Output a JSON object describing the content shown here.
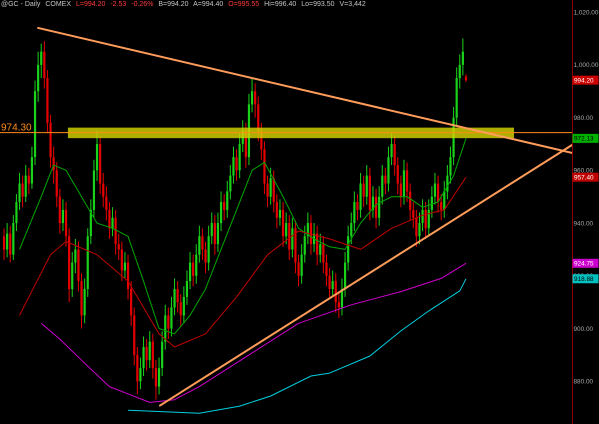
{
  "header": {
    "symbol": "@GC - Daily",
    "exchange": "COMEX",
    "last": "L=994.20",
    "change": "-2.53",
    "change_pct": "-0.26%",
    "bid": "B=994.20",
    "ask": "A=994.40",
    "open": "O=995.55",
    "high": "Hi=996.40",
    "low": "Lo=993.50",
    "volume": "V=3,442"
  },
  "chart_data": {
    "type": "bar",
    "subtype": "candlestick",
    "title": "",
    "xlabel": "",
    "ylabel": "",
    "xlim": [
      -1.3,
      183.2
    ],
    "ylim": [
      863.8,
      1024.6
    ],
    "grid": false,
    "colors": {
      "up": "#19d219",
      "down": "#e60000",
      "axis_text": "#a8a8a8",
      "axis_line": "#8b0000"
    },
    "yticks": [
      {
        "value": 1020,
        "label": "1,020.00"
      },
      {
        "value": 1000,
        "label": "1,000.00"
      },
      {
        "value": 980,
        "label": "980.00"
      },
      {
        "value": 960,
        "label": "960.00"
      },
      {
        "value": 940,
        "label": "940.00"
      },
      {
        "value": 920,
        "label": "920.00"
      },
      {
        "value": 900,
        "label": "900.00"
      },
      {
        "value": 880,
        "label": "880.00"
      }
    ],
    "ohlc": [
      [
        935,
        938,
        926,
        930
      ],
      [
        930,
        940,
        927,
        936
      ],
      [
        936,
        939,
        925,
        928
      ],
      [
        928,
        943,
        926,
        940
      ],
      [
        940,
        951,
        937,
        948
      ],
      [
        948,
        959,
        945,
        955
      ],
      [
        955,
        958,
        946,
        950
      ],
      [
        950,
        962,
        948,
        958
      ],
      [
        958,
        961,
        951,
        955
      ],
      [
        955,
        969,
        953,
        965
      ],
      [
        965,
        994,
        962,
        990
      ],
      [
        990,
        1005,
        986,
        1000
      ],
      [
        1000,
        1008,
        995,
        1005
      ],
      [
        1005,
        1009,
        991,
        995
      ],
      [
        995,
        998,
        974,
        978
      ],
      [
        978,
        981,
        961,
        965
      ],
      [
        965,
        969,
        955,
        960
      ],
      [
        960,
        963,
        946,
        950
      ],
      [
        950,
        953,
        936,
        940
      ],
      [
        940,
        949,
        937,
        945
      ],
      [
        945,
        948,
        931,
        935
      ],
      [
        935,
        938,
        910,
        915
      ],
      [
        915,
        929,
        912,
        925
      ],
      [
        925,
        934,
        921,
        930
      ],
      [
        930,
        933,
        914,
        918
      ],
      [
        918,
        921,
        900,
        905
      ],
      [
        905,
        919,
        902,
        915
      ],
      [
        915,
        938,
        912,
        935
      ],
      [
        935,
        949,
        932,
        945
      ],
      [
        945,
        964,
        942,
        960
      ],
      [
        960,
        975,
        956,
        970
      ],
      [
        970,
        973,
        951,
        955
      ],
      [
        955,
        959,
        946,
        950
      ],
      [
        950,
        954,
        941,
        945
      ],
      [
        945,
        948,
        934,
        938
      ],
      [
        938,
        946,
        935,
        942
      ],
      [
        942,
        945,
        928,
        932
      ],
      [
        932,
        936,
        926,
        930
      ],
      [
        930,
        933,
        918,
        922
      ],
      [
        922,
        929,
        919,
        925
      ],
      [
        925,
        928,
        911,
        915
      ],
      [
        915,
        918,
        901,
        905
      ],
      [
        905,
        908,
        886,
        890
      ],
      [
        890,
        893,
        875,
        880
      ],
      [
        880,
        889,
        877,
        885
      ],
      [
        885,
        897,
        882,
        893
      ],
      [
        893,
        896,
        884,
        888
      ],
      [
        888,
        899,
        885,
        895
      ],
      [
        895,
        898,
        881,
        885
      ],
      [
        885,
        888,
        873,
        878
      ],
      [
        878,
        889,
        875,
        885
      ],
      [
        885,
        899,
        882,
        895
      ],
      [
        895,
        909,
        892,
        905
      ],
      [
        905,
        908,
        896,
        900
      ],
      [
        900,
        912,
        897,
        908
      ],
      [
        908,
        919,
        905,
        915
      ],
      [
        915,
        918,
        906,
        910
      ],
      [
        910,
        913,
        901,
        905
      ],
      [
        905,
        916,
        902,
        912
      ],
      [
        912,
        922,
        909,
        918
      ],
      [
        918,
        929,
        915,
        925
      ],
      [
        925,
        928,
        916,
        920
      ],
      [
        920,
        932,
        917,
        928
      ],
      [
        928,
        939,
        925,
        935
      ],
      [
        935,
        938,
        926,
        930
      ],
      [
        930,
        933,
        921,
        925
      ],
      [
        925,
        939,
        922,
        935
      ],
      [
        935,
        944,
        932,
        940
      ],
      [
        940,
        943,
        928,
        932
      ],
      [
        932,
        944,
        929,
        940
      ],
      [
        940,
        952,
        937,
        948
      ],
      [
        948,
        951,
        941,
        945
      ],
      [
        945,
        956,
        942,
        952
      ],
      [
        952,
        962,
        949,
        958
      ],
      [
        958,
        969,
        955,
        965
      ],
      [
        965,
        968,
        956,
        960
      ],
      [
        960,
        974,
        957,
        970
      ],
      [
        970,
        979,
        967,
        975
      ],
      [
        975,
        978,
        961,
        965
      ],
      [
        965,
        989,
        962,
        985
      ],
      [
        985,
        995,
        982,
        990
      ],
      [
        990,
        993,
        980,
        985
      ],
      [
        985,
        988,
        971,
        975
      ],
      [
        975,
        978,
        964,
        968
      ],
      [
        968,
        971,
        951,
        955
      ],
      [
        955,
        958,
        946,
        950
      ],
      [
        950,
        961,
        947,
        957
      ],
      [
        957,
        960,
        944,
        948
      ],
      [
        948,
        951,
        938,
        942
      ],
      [
        942,
        949,
        939,
        945
      ],
      [
        945,
        948,
        931,
        935
      ],
      [
        935,
        944,
        932,
        940
      ],
      [
        940,
        943,
        926,
        930
      ],
      [
        930,
        942,
        927,
        938
      ],
      [
        938,
        941,
        921,
        925
      ],
      [
        925,
        928,
        916,
        920
      ],
      [
        920,
        932,
        917,
        928
      ],
      [
        928,
        939,
        925,
        935
      ],
      [
        935,
        944,
        932,
        940
      ],
      [
        940,
        943,
        928,
        932
      ],
      [
        932,
        940,
        929,
        936
      ],
      [
        936,
        939,
        924,
        928
      ],
      [
        928,
        936,
        925,
        932
      ],
      [
        932,
        935,
        921,
        925
      ],
      [
        925,
        928,
        916,
        920
      ],
      [
        920,
        923,
        911,
        915
      ],
      [
        915,
        922,
        912,
        918
      ],
      [
        918,
        921,
        906,
        910
      ],
      [
        910,
        914,
        904,
        908
      ],
      [
        908,
        919,
        905,
        915
      ],
      [
        915,
        929,
        912,
        925
      ],
      [
        925,
        939,
        922,
        935
      ],
      [
        935,
        944,
        932,
        940
      ],
      [
        940,
        952,
        937,
        948
      ],
      [
        948,
        951,
        941,
        945
      ],
      [
        945,
        959,
        942,
        955
      ],
      [
        955,
        958,
        946,
        950
      ],
      [
        950,
        962,
        947,
        958
      ],
      [
        958,
        961,
        941,
        945
      ],
      [
        945,
        954,
        942,
        950
      ],
      [
        950,
        953,
        938,
        942
      ],
      [
        942,
        954,
        939,
        950
      ],
      [
        950,
        962,
        947,
        958
      ],
      [
        958,
        961,
        951,
        955
      ],
      [
        955,
        969,
        952,
        965
      ],
      [
        965,
        974,
        962,
        970
      ],
      [
        970,
        973,
        958,
        962
      ],
      [
        962,
        965,
        951,
        955
      ],
      [
        955,
        958,
        946,
        950
      ],
      [
        950,
        964,
        947,
        960
      ],
      [
        960,
        963,
        948,
        952
      ],
      [
        952,
        955,
        941,
        945
      ],
      [
        945,
        948,
        938,
        942
      ],
      [
        942,
        945,
        931,
        935
      ],
      [
        935,
        944,
        932,
        940
      ],
      [
        940,
        949,
        937,
        945
      ],
      [
        945,
        948,
        934,
        938
      ],
      [
        938,
        949,
        935,
        945
      ],
      [
        945,
        954,
        942,
        950
      ],
      [
        950,
        959,
        947,
        955
      ],
      [
        955,
        958,
        944,
        948
      ],
      [
        948,
        951,
        941,
        945
      ],
      [
        945,
        956,
        942,
        952
      ],
      [
        952,
        962,
        949,
        958
      ],
      [
        958,
        969,
        955,
        965
      ],
      [
        965,
        984,
        962,
        980
      ],
      [
        980,
        999,
        977,
        995
      ],
      [
        995,
        1004,
        991,
        1000
      ],
      [
        1000,
        1010,
        996,
        1005
      ],
      [
        995.55,
        996.4,
        993.5,
        994.2
      ]
    ],
    "lines": [
      {
        "color": "#00a800",
        "points": [
          [
            5,
            930
          ],
          [
            12,
            950
          ],
          [
            16,
            962
          ],
          [
            20,
            960
          ],
          [
            25,
            950
          ],
          [
            30,
            940
          ],
          [
            35,
            938
          ],
          [
            40,
            935
          ],
          [
            45,
            918
          ],
          [
            50,
            900
          ],
          [
            55,
            898
          ],
          [
            60,
            905
          ],
          [
            65,
            915
          ],
          [
            70,
            930
          ],
          [
            75,
            945
          ],
          [
            80,
            960
          ],
          [
            84,
            963
          ],
          [
            90,
            950
          ],
          [
            95,
            938
          ],
          [
            100,
            934
          ],
          [
            105,
            931
          ],
          [
            110,
            930
          ],
          [
            115,
            940
          ],
          [
            120,
            947
          ],
          [
            125,
            950
          ],
          [
            130,
            950
          ],
          [
            135,
            946
          ],
          [
            140,
            948
          ],
          [
            145,
            958
          ],
          [
            149,
            972.13
          ]
        ]
      },
      {
        "color": "#c00000",
        "points": [
          [
            5,
            905
          ],
          [
            15,
            928
          ],
          [
            20,
            933
          ],
          [
            30,
            928
          ],
          [
            40,
            918
          ],
          [
            50,
            898
          ],
          [
            55,
            893
          ],
          [
            65,
            898
          ],
          [
            75,
            912
          ],
          [
            85,
            928
          ],
          [
            95,
            937
          ],
          [
            105,
            934
          ],
          [
            115,
            930
          ],
          [
            125,
            938
          ],
          [
            135,
            943
          ],
          [
            142,
            945
          ],
          [
            149,
            957.4
          ]
        ]
      },
      {
        "color": "#d000d0",
        "points": [
          [
            12,
            902
          ],
          [
            18,
            896
          ],
          [
            25,
            888
          ],
          [
            34,
            878
          ],
          [
            47,
            872
          ],
          [
            55,
            873
          ],
          [
            63,
            878
          ],
          [
            79,
            890
          ],
          [
            95,
            902
          ],
          [
            112,
            909
          ],
          [
            128,
            914
          ],
          [
            141,
            919
          ],
          [
            149,
            924.75
          ]
        ]
      },
      {
        "color": "#00d0e0",
        "points": [
          [
            40,
            869
          ],
          [
            47,
            868.7
          ],
          [
            63,
            867.9
          ],
          [
            76,
            870.6
          ],
          [
            86,
            874.4
          ],
          [
            99,
            882
          ],
          [
            105,
            883.1
          ],
          [
            118,
            889.6
          ],
          [
            128,
            899.1
          ],
          [
            137,
            906.7
          ],
          [
            147,
            914.3
          ],
          [
            149,
            918.88
          ]
        ]
      }
    ],
    "trendlines": [
      {
        "color": "#ff9c5a",
        "from": [
          11,
          1014
        ],
        "to": [
          183.2,
          966.6
        ]
      },
      {
        "color": "#ff9c5a",
        "from": [
          50.3,
          870.8
        ],
        "to": [
          183.2,
          969.6
        ]
      }
    ],
    "horizontal_line": {
      "value": 974.3,
      "label": "974.30",
      "color": "#ff8c1a"
    },
    "highlight_band": {
      "from_index": 20.6,
      "to_index": 164.5,
      "low": 972.2,
      "high": 976.2,
      "color": "#d4d400"
    },
    "price_markers": [
      {
        "value": 994.2,
        "label": "994.20",
        "bg": "#cc0000",
        "fg": "#ffffff"
      },
      {
        "value": 972.13,
        "label": "972.13",
        "bg": "#00b000",
        "fg": "#000000"
      },
      {
        "value": 957.4,
        "label": "957.40",
        "bg": "#c00000",
        "fg": "#ffffff"
      },
      {
        "value": 924.75,
        "label": "924.75",
        "bg": "#cc00cc",
        "fg": "#ffffff"
      },
      {
        "value": 918.88,
        "label": "918.88",
        "bg": "#00c0c0",
        "fg": "#000000"
      }
    ]
  }
}
